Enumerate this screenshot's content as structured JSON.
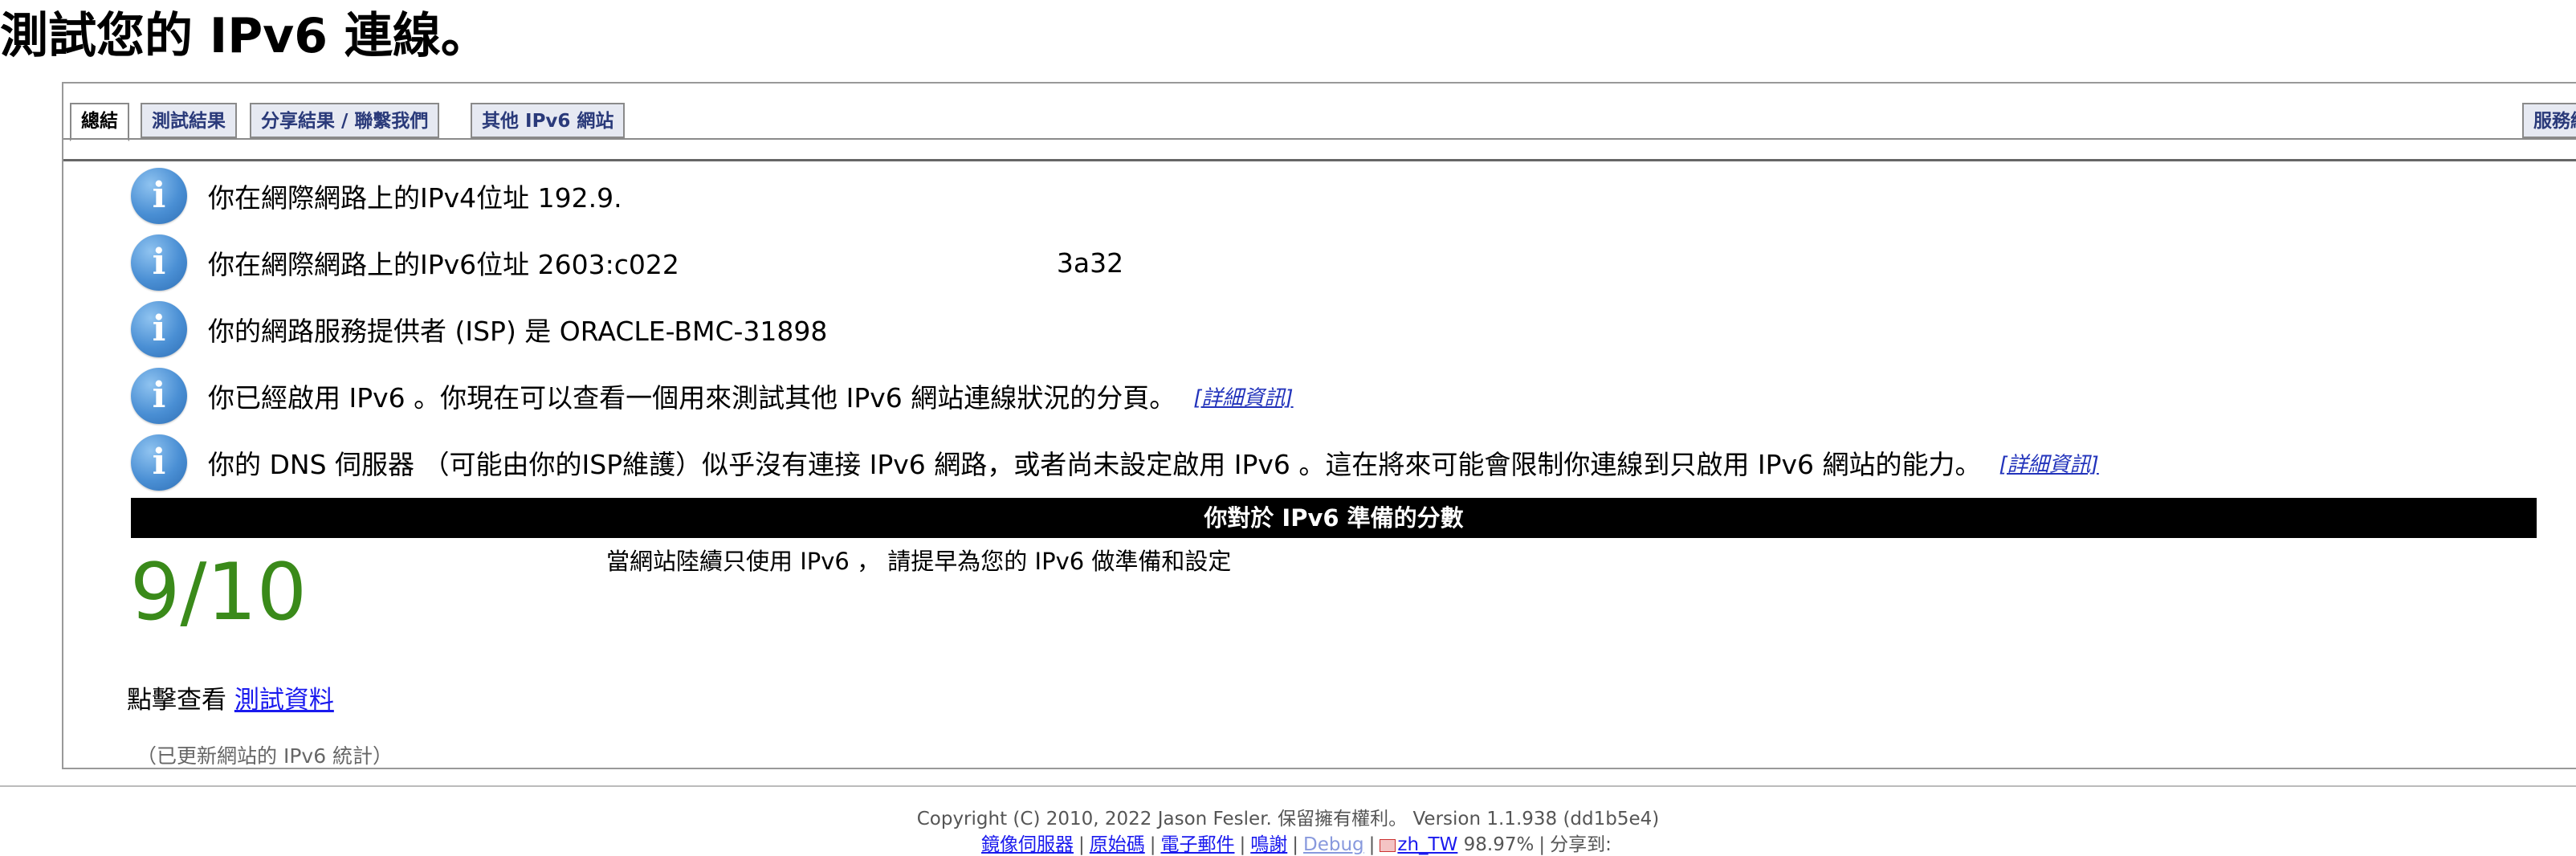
{
  "page": {
    "title": "測試您的 IPv6 連線。"
  },
  "tabs": [
    {
      "label": "總結",
      "active": true
    },
    {
      "label": "測試結果",
      "active": false
    },
    {
      "label": "分享結果 / 聯繫我們",
      "active": false
    },
    {
      "label": "其他 IPv6 網站",
      "active": false
    },
    {
      "label": "服務網",
      "active": false
    }
  ],
  "info": {
    "ipv4": "你在網際網路上的IPv4位址 192.9.",
    "ipv6_prefix": "你在網際網路上的IPv6位址 2603:c022",
    "ipv6_suffix": "3a32",
    "isp": "你的網路服務提供者 (ISP) 是 ORACLE-BMC-31898",
    "ipv6_enabled": "你已經啟用 IPv6 。你現在可以查看一個用來測試其他 IPv6 網站連線狀況的分頁。",
    "dns": "你的 DNS 伺服器 （可能由你的ISP維護）似乎沒有連接 IPv6 網路，或者尚未設定啟用 IPv6 。這在將來可能會限制你連線到只啟用 IPv6 網站的能力。",
    "detail_link": "[詳細資訊]"
  },
  "score": {
    "header": "你對於 IPv6 準備的分數",
    "value": "9/10",
    "description": "當網站陸續只使用 IPv6 ， 請提早為您的 IPv6 做準備和設定",
    "value_color": "#3a8a1a"
  },
  "test_data": {
    "prefix": "點擊查看",
    "link": "測試資料"
  },
  "stats_note": "（已更新網站的 IPv6 統計）",
  "footer": {
    "copyright": "Copyright (C) 2010, 2022 Jason Fesler. 保留擁有權利。 Version 1.1.938 (dd1b5e4)",
    "links": {
      "mirrors": "鏡像伺服器",
      "source": "原始碼",
      "email": "電子郵件",
      "thanks": "鳴謝",
      "debug": "Debug",
      "locale": "zh_TW",
      "percent": "98.97%",
      "share": "分享到:"
    }
  },
  "icons": {
    "info": "info-icon",
    "info_glyph": "i",
    "flag": "flag-icon"
  }
}
